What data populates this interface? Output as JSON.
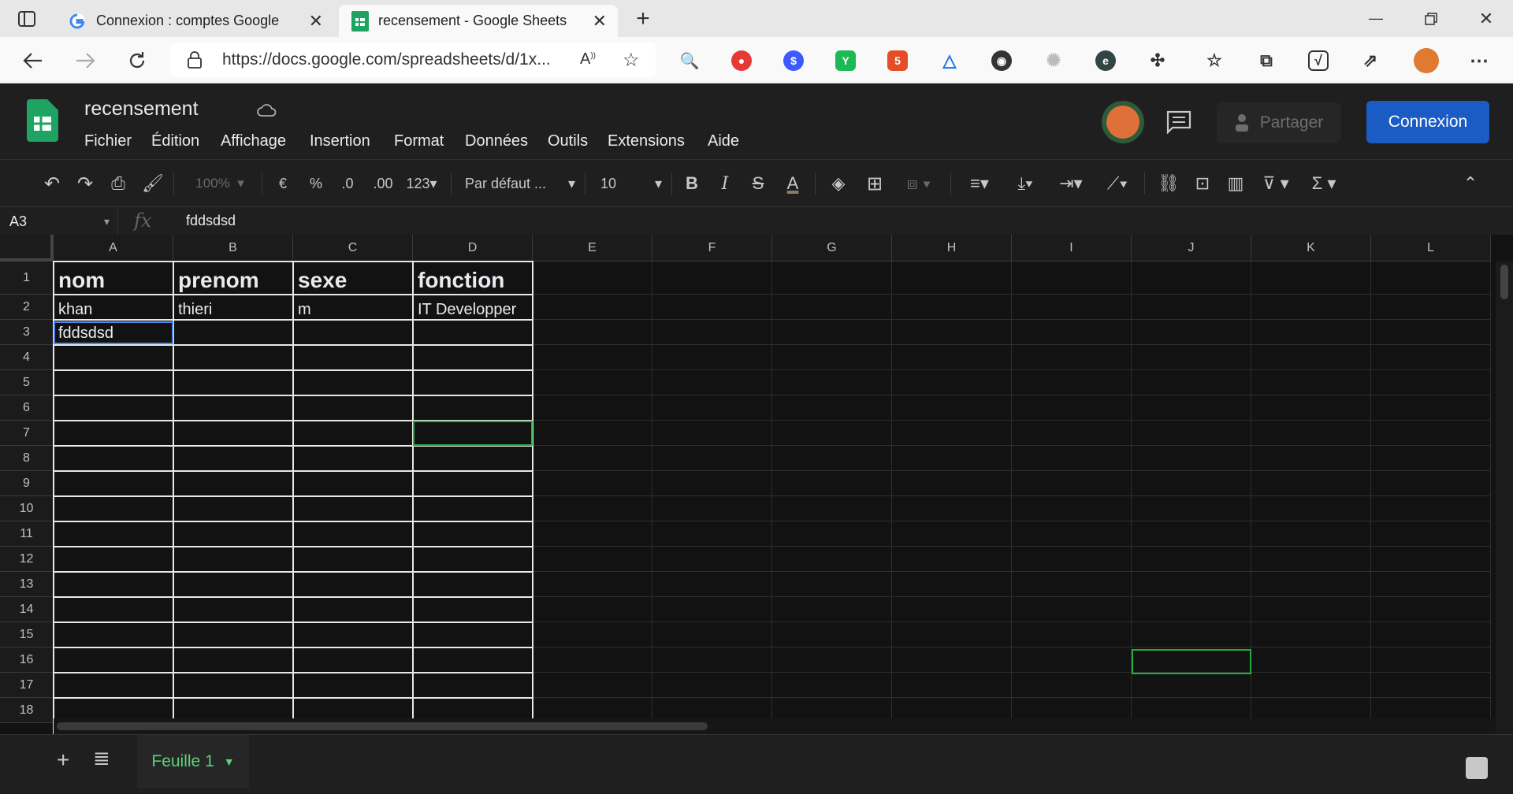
{
  "browser": {
    "tabs": [
      {
        "title": "Connexion : comptes Google",
        "active": false
      },
      {
        "title": "recensement - Google Sheets",
        "active": true
      }
    ],
    "url": "https://docs.google.com/spreadsheets/d/1x..."
  },
  "doc": {
    "title": "recensement",
    "menu": [
      "Fichier",
      "Édition",
      "Affichage",
      "Insertion",
      "Format",
      "Données",
      "Outils",
      "Extensions",
      "Aide"
    ],
    "share_label": "Partager",
    "login_label": "Connexion"
  },
  "toolbar": {
    "zoom": "100%",
    "currency": "€",
    "percent": "%",
    "dec_decrease": ".0",
    "dec_increase": ".00",
    "number_format": "123",
    "font": "Par défaut ...",
    "font_size": "10"
  },
  "formula": {
    "cell_ref": "A3",
    "fx": "fx",
    "value": "fddsdsd"
  },
  "grid": {
    "columns": [
      "A",
      "B",
      "C",
      "D",
      "E",
      "F",
      "G",
      "H",
      "I",
      "J",
      "K",
      "L"
    ],
    "rows": [
      "1",
      "2",
      "3",
      "4",
      "5",
      "6",
      "7",
      "8",
      "9",
      "10",
      "11",
      "12",
      "13",
      "14",
      "15",
      "16",
      "17",
      "18"
    ],
    "cells": {
      "header": [
        "nom",
        "prenom",
        "sexe",
        "fonction"
      ],
      "row2": [
        "khan",
        "thieri",
        "m",
        "IT Developper"
      ],
      "row3": [
        "fddsdsd"
      ]
    }
  },
  "sheet_tab": "Feuille 1",
  "colors": {
    "accent_green": "#5ad47a",
    "login_blue": "#1a5bc4",
    "selection_blue": "#4a8af4",
    "green_highlight": "#20b040"
  }
}
